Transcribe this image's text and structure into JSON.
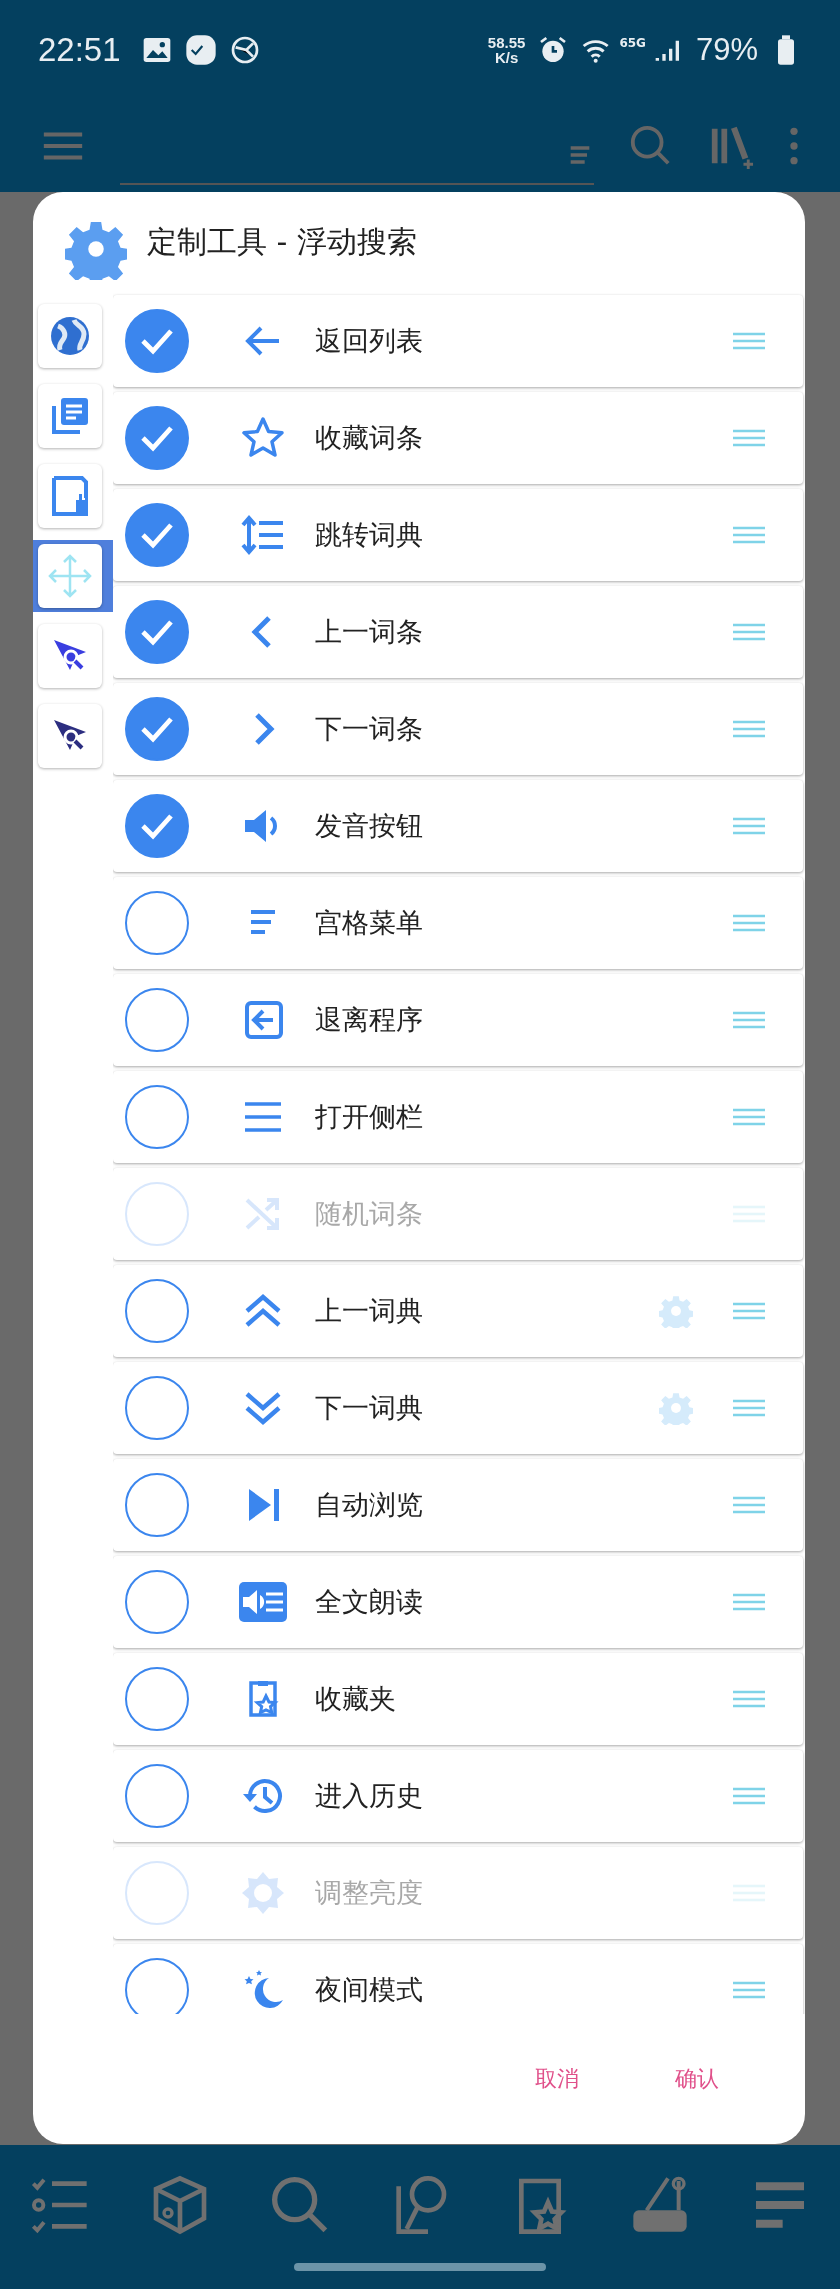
{
  "status_bar": {
    "time": "22:51",
    "net_speed": {
      "value": "58.55",
      "unit": "K/s"
    },
    "wifi_label": "6",
    "network": "5G",
    "battery": "79%"
  },
  "dialog": {
    "title": "定制工具 - 浮动搜索",
    "side_tabs": [
      {
        "selected": false
      },
      {
        "selected": false
      },
      {
        "selected": false
      },
      {
        "selected": true
      },
      {
        "selected": false
      },
      {
        "selected": false
      }
    ],
    "rows": [
      {
        "label": "返回列表",
        "checked": true,
        "disabled": false,
        "settings": false
      },
      {
        "label": "收藏词条",
        "checked": true,
        "disabled": false,
        "settings": false
      },
      {
        "label": "跳转词典",
        "checked": true,
        "disabled": false,
        "settings": false
      },
      {
        "label": "上一词条",
        "checked": true,
        "disabled": false,
        "settings": false
      },
      {
        "label": "下一词条",
        "checked": true,
        "disabled": false,
        "settings": false
      },
      {
        "label": "发音按钮",
        "checked": true,
        "disabled": false,
        "settings": false
      },
      {
        "label": "宫格菜单",
        "checked": false,
        "disabled": false,
        "settings": false
      },
      {
        "label": "退离程序",
        "checked": false,
        "disabled": false,
        "settings": false
      },
      {
        "label": "打开侧栏",
        "checked": false,
        "disabled": false,
        "settings": false
      },
      {
        "label": "随机词条",
        "checked": false,
        "disabled": true,
        "settings": false
      },
      {
        "label": "上一词典",
        "checked": false,
        "disabled": false,
        "settings": true
      },
      {
        "label": "下一词典",
        "checked": false,
        "disabled": false,
        "settings": true
      },
      {
        "label": "自动浏览",
        "checked": false,
        "disabled": false,
        "settings": false
      },
      {
        "label": "全文朗读",
        "checked": false,
        "disabled": false,
        "settings": false
      },
      {
        "label": "收藏夹",
        "checked": false,
        "disabled": false,
        "settings": false
      },
      {
        "label": "进入历史",
        "checked": false,
        "disabled": false,
        "settings": false
      },
      {
        "label": "调整亮度",
        "checked": false,
        "disabled": true,
        "settings": false
      },
      {
        "label": "夜间模式",
        "checked": false,
        "disabled": false,
        "settings": false
      }
    ],
    "buttons": [
      {
        "label": "取消"
      },
      {
        "label": "确认"
      }
    ]
  }
}
